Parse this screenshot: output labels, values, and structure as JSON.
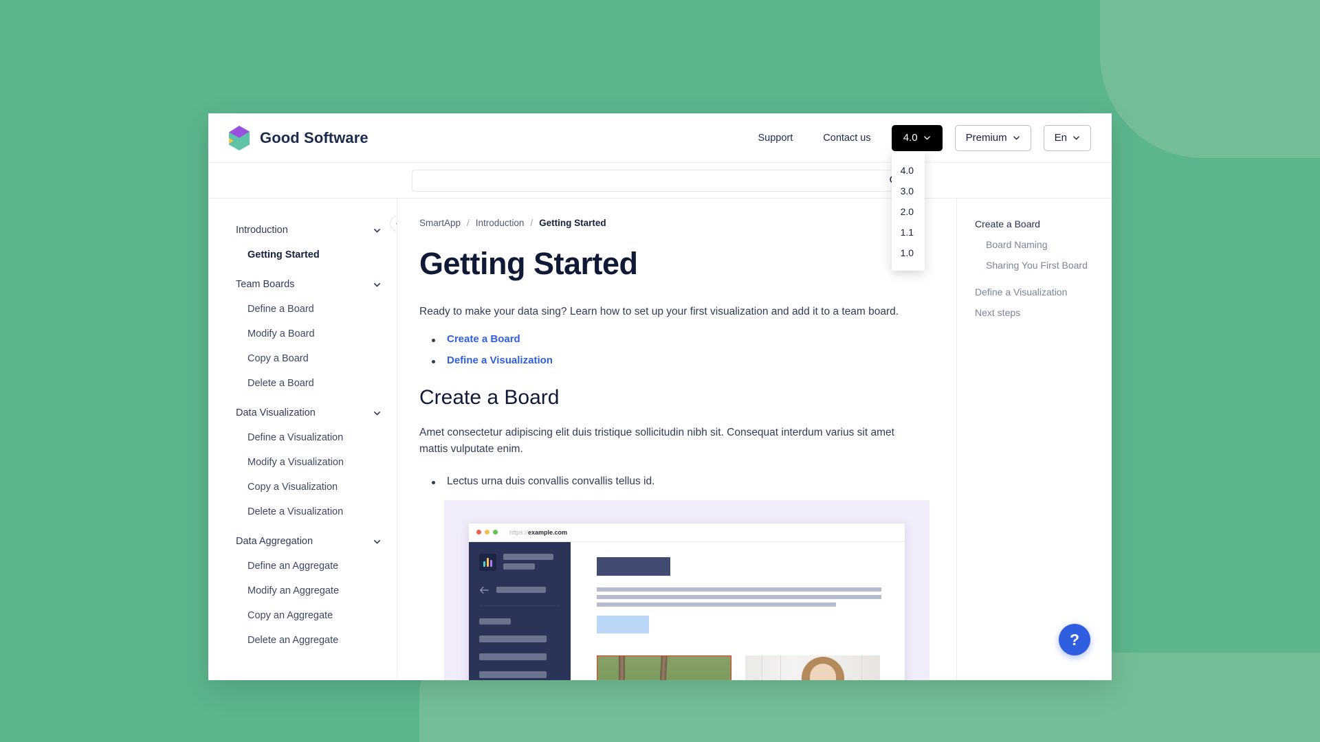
{
  "theme": {
    "page_background": "#5BB68C",
    "blob_color": "#74BE97",
    "accent_link": "#2F5FE0",
    "text_dark": "#101A36"
  },
  "header": {
    "brand_name": "Good Software",
    "nav_links": [
      {
        "label": "Support"
      },
      {
        "label": "Contact us"
      }
    ],
    "version_button": {
      "label": "4.0"
    },
    "version_menu": {
      "open": true,
      "options": [
        "4.0",
        "3.0",
        "2.0",
        "1.1",
        "1.0"
      ]
    },
    "plan_button": {
      "label": "Premium"
    },
    "language_button": {
      "label": "En"
    }
  },
  "search": {
    "value": "",
    "placeholder": ""
  },
  "sidebar": {
    "groups": [
      {
        "label": "Introduction",
        "expanded": true,
        "items": [
          {
            "label": "Getting Started",
            "active": true
          }
        ]
      },
      {
        "label": "Team Boards",
        "expanded": true,
        "items": [
          {
            "label": "Define a Board",
            "active": false
          },
          {
            "label": "Modify a Board",
            "active": false
          },
          {
            "label": "Copy a Board",
            "active": false
          },
          {
            "label": "Delete a Board",
            "active": false
          }
        ]
      },
      {
        "label": "Data Visualization",
        "expanded": true,
        "items": [
          {
            "label": "Define a Visualization",
            "active": false
          },
          {
            "label": "Modify a Visualization",
            "active": false
          },
          {
            "label": "Copy a Visualization",
            "active": false
          },
          {
            "label": "Delete a Visualization",
            "active": false
          }
        ]
      },
      {
        "label": "Data Aggregation",
        "expanded": true,
        "items": [
          {
            "label": "Define an Aggregate",
            "active": false
          },
          {
            "label": "Modify an Aggregate",
            "active": false
          },
          {
            "label": "Copy an Aggregate",
            "active": false
          },
          {
            "label": "Delete an Aggregate",
            "active": false
          }
        ]
      }
    ]
  },
  "main": {
    "breadcrumb": [
      {
        "label": "SmartApp",
        "current": false
      },
      {
        "label": "Introduction",
        "current": false
      },
      {
        "label": "Getting Started",
        "current": true
      }
    ],
    "breadcrumb_separator": "/",
    "title": "Getting Started",
    "intro": "Ready to make your data sing? Learn how to set up your first visualization and add it to a team board.",
    "quick_links": [
      {
        "label": "Create a Board"
      },
      {
        "label": "Define a Visualization"
      }
    ],
    "section": {
      "title": "Create a Board",
      "body": "Amet consectetur adipiscing elit duis tristique sollicitudin nibh sit. Consequat interdum varius sit amet mattis vulputate enim.",
      "bullets": [
        {
          "label": "Lectus urna duis convallis convallis tellus id."
        }
      ]
    },
    "figure": {
      "browser_url_protocol": "https://",
      "browser_url_domain": "example.com"
    }
  },
  "toc": {
    "items": [
      {
        "label": "Create a Board",
        "level": 1,
        "active": true
      },
      {
        "label": "Board Naming",
        "level": 2,
        "active": false
      },
      {
        "label": "Sharing You First Board",
        "level": 2,
        "active": false
      },
      {
        "label": "Define a Visualization",
        "level": 1,
        "active": false
      },
      {
        "label": "Next steps",
        "level": 1,
        "active": false
      }
    ]
  },
  "help": {
    "label": "?"
  },
  "icons": {
    "search": "search-icon",
    "chevron_down": "chevron-down-icon",
    "chevron_left": "chevron-left-icon",
    "logo": "cube-logo-icon",
    "help": "question-mark-icon"
  }
}
